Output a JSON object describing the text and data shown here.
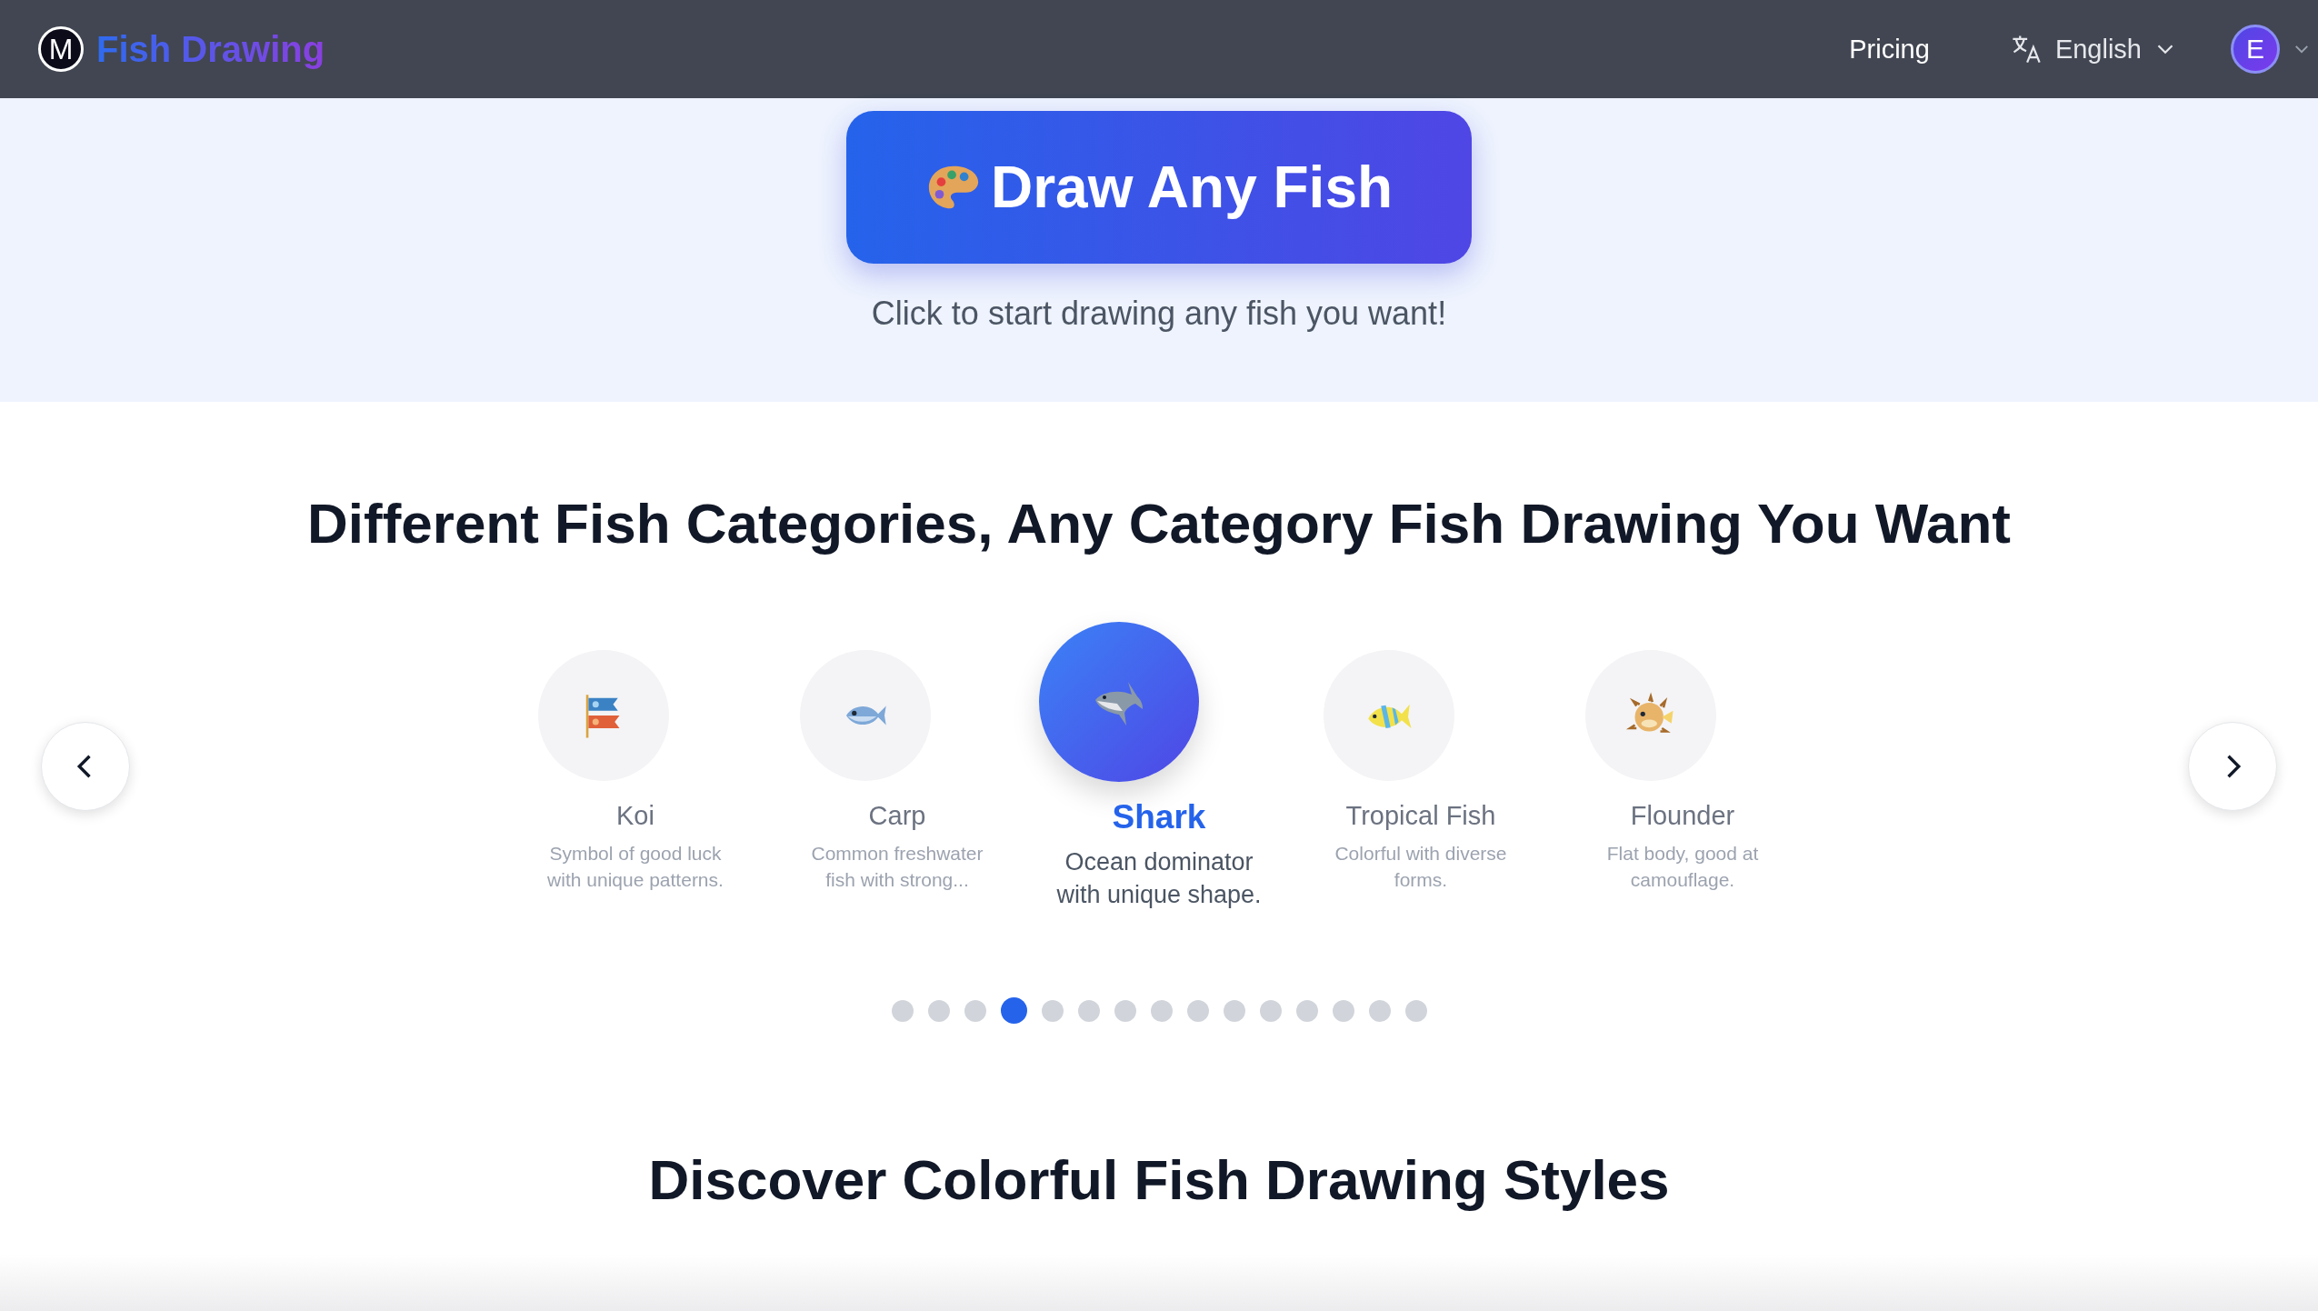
{
  "header": {
    "logo_letter": "M",
    "brand": "Fish Drawing",
    "nav": [
      {
        "label": "Pricing"
      }
    ],
    "language": "English",
    "avatar": "E"
  },
  "hero": {
    "button": "Draw Any Fish",
    "subtitle": "Click to start drawing any fish you want!"
  },
  "categories": {
    "title": "Different Fish Categories, Any Category Fish Drawing You Want",
    "items": [
      {
        "kind": "koi",
        "name": "Koi",
        "description": "Symbol of good luck with unique patterns.",
        "selected": false
      },
      {
        "kind": "carp",
        "name": "Carp",
        "description": "Common freshwater fish with strong...",
        "selected": false
      },
      {
        "kind": "shark",
        "name": "Shark",
        "description": "Ocean dominator with unique shape.",
        "selected": true
      },
      {
        "kind": "tropical",
        "name": "Tropical Fish",
        "description": "Colorful with diverse forms.",
        "selected": false
      },
      {
        "kind": "puffer",
        "name": "Flounder",
        "description": "Flat body, good at camouflage.",
        "selected": false
      }
    ],
    "dots": [
      {
        "selected": false
      },
      {
        "selected": false
      },
      {
        "selected": false
      },
      {
        "selected": true
      },
      {
        "selected": false
      },
      {
        "selected": false
      },
      {
        "selected": false
      },
      {
        "selected": false
      },
      {
        "selected": false
      },
      {
        "selected": false
      },
      {
        "selected": false
      },
      {
        "selected": false
      },
      {
        "selected": false
      },
      {
        "selected": false
      },
      {
        "selected": false
      }
    ]
  },
  "styles_section": {
    "title": "Discover Colorful Fish Drawing Styles"
  }
}
